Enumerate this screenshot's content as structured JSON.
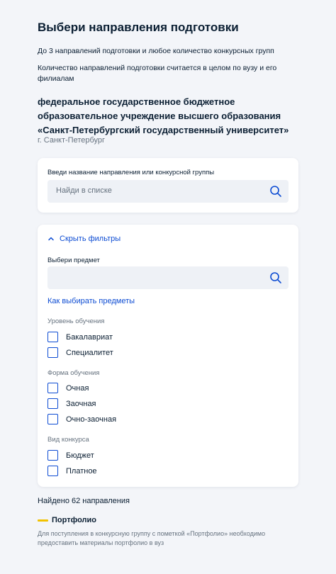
{
  "header": {
    "title": "Выбери направления подготовки",
    "info1": "До 3 направлений подготовки и любое количество конкурсных групп",
    "info2": "Количество направлений подготовки считается в целом по вузу и его филиалам"
  },
  "university": {
    "name": "федеральное государственное бюджетное образовательное учреждение высшего образования «Санкт-Петербургский государственный университет»",
    "city": "г. Санкт-Петербург"
  },
  "search": {
    "label": "Введи название направления или конкурсной группы",
    "placeholder": "Найди в списке"
  },
  "filters": {
    "toggle_label": "Скрыть фильтры",
    "subject_label": "Выбери предмет",
    "subject_placeholder": "",
    "how_to_link": "Как выбирать предметы",
    "groups": [
      {
        "label": "Уровень обучения",
        "options": [
          {
            "label": "Бакалавриат",
            "checked": false
          },
          {
            "label": "Специалитет",
            "checked": false
          }
        ]
      },
      {
        "label": "Форма обучения",
        "options": [
          {
            "label": "Очная",
            "checked": false
          },
          {
            "label": "Заочная",
            "checked": false
          },
          {
            "label": "Очно-заочная",
            "checked": false
          }
        ]
      },
      {
        "label": "Вид конкурса",
        "options": [
          {
            "label": "Бюджет",
            "checked": false
          },
          {
            "label": "Платное",
            "checked": false
          }
        ]
      }
    ]
  },
  "results": {
    "found_text": "Найдено 62 направления"
  },
  "legend": {
    "label": "Портфолио",
    "color": "#f2c200",
    "note": "Для поступления в конкурсную группу с пометкой «Портфолио» необходимо предоставить материалы портфолио в вуз"
  },
  "icons": {
    "search": "search-icon",
    "chevron": "chevron-up-icon"
  },
  "colors": {
    "accent": "#0d4cd3",
    "background": "#f3f5f9",
    "text": "#0b1f33",
    "secondary_text": "#66727f",
    "input_bg": "#eef1f6"
  }
}
